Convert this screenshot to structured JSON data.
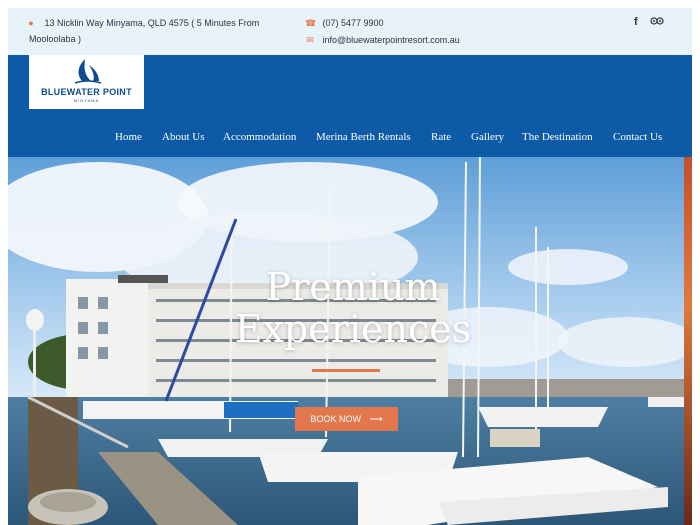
{
  "topbar": {
    "address_line1": "13 Nicklin Way Minyama, QLD 4575 ( 5 Minutes From",
    "address_line2": "Mooloolaba )",
    "phone": "(07) 5477 9900",
    "email": "info@bluewaterpointresort.com.au",
    "icons": [
      "map-pin-icon",
      "phone-icon",
      "mail-icon",
      "facebook-icon",
      "tripadvisor-icon"
    ],
    "accent_color": "#e2774e"
  },
  "header": {
    "background_color": "#0d5aa7",
    "logo_text": "BLUEWATER POINT",
    "logo_subtext": "MINYAMA",
    "nav": [
      "Home",
      "About Us",
      "Accommodation",
      "Merina Berth Rentals",
      "Rate",
      "Gallery",
      "The Destination",
      "Contact Us"
    ]
  },
  "hero": {
    "title_line1": "Premium",
    "title_line2": "Experiences",
    "button_label": "BOOK NOW",
    "button_icon": "arrow-right-icon",
    "button_color": "#e2774e"
  }
}
